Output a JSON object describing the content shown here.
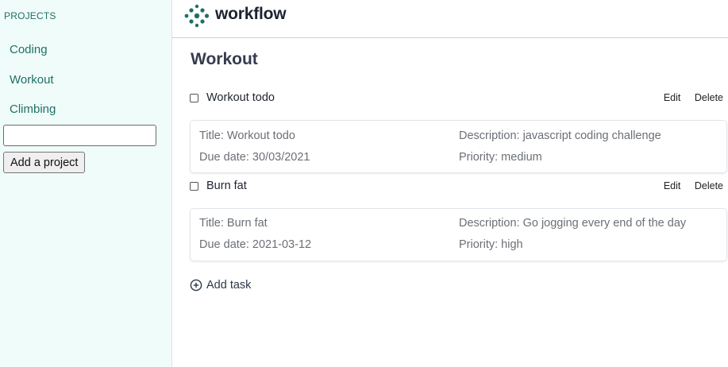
{
  "sidebar": {
    "heading": "PROJECTS",
    "projects": [
      {
        "label": "Coding"
      },
      {
        "label": "Workout"
      },
      {
        "label": "Climbing"
      }
    ],
    "new_project_input": {
      "value": "",
      "placeholder": ""
    },
    "add_project_label": "Add a project"
  },
  "header": {
    "logo_text": "workflow",
    "logo_icon": "workflow-logo-icon",
    "brand_color": "#1f6f68"
  },
  "main": {
    "title": "Workout",
    "tasks": [
      {
        "name": "Workout todo",
        "checked": false,
        "edit_label": "Edit",
        "delete_label": "Delete",
        "title": "Title: Workout todo",
        "description": "Description: javascript coding challenge",
        "due": "Due date: 30/03/2021",
        "priority": "Priority: medium"
      },
      {
        "name": "Burn fat",
        "checked": false,
        "edit_label": "Edit",
        "delete_label": "Delete",
        "title": "Title: Burn fat",
        "description": "Description: Go jogging every end of the day",
        "due": "Due date: 2021-03-12",
        "priority": "Priority: high"
      }
    ],
    "add_task_label": "Add task",
    "add_task_icon": "plus-circle-icon"
  }
}
